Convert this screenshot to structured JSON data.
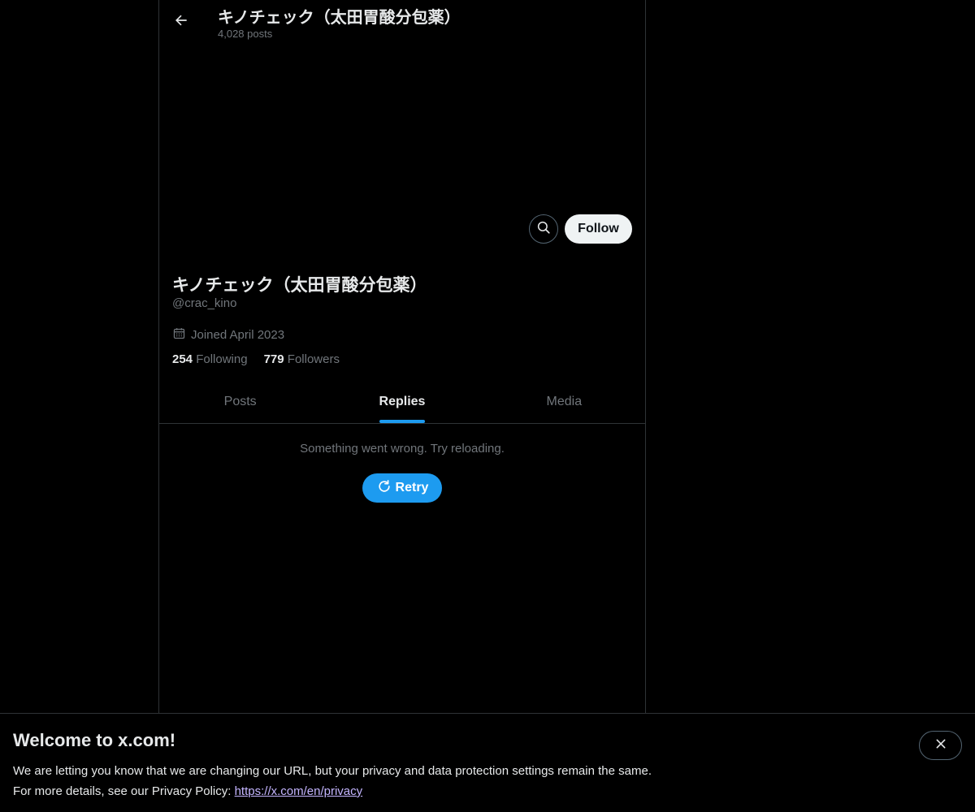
{
  "header": {
    "title": "キノチェック（太田胃酸分包薬）",
    "posts_count": "4,028 posts"
  },
  "actions": {
    "follow_label": "Follow"
  },
  "profile": {
    "display_name": "キノチェック（太田胃酸分包薬）",
    "handle": "@crac_kino",
    "joined": "Joined April 2023",
    "following_count": "254",
    "following_label": "Following",
    "followers_count": "779",
    "followers_label": "Followers"
  },
  "tabs": [
    {
      "label": "Posts",
      "active": false
    },
    {
      "label": "Replies",
      "active": true
    },
    {
      "label": "Media",
      "active": false
    }
  ],
  "error": {
    "message": "Something went wrong. Try reloading.",
    "retry_label": "Retry"
  },
  "welcome": {
    "title": "Welcome to x.com!",
    "line1": "We are letting you know that we are changing our URL, but your privacy and data protection settings remain the same.",
    "line2_prefix": "For more details, see our Privacy Policy: ",
    "link": "https://x.com/en/privacy"
  },
  "colors": {
    "background": "#000000",
    "accent": "#1d9bf0",
    "text_primary": "#e7e9ea",
    "text_secondary": "#71767b",
    "border": "#2f3336",
    "link": "#c4b5ff"
  }
}
